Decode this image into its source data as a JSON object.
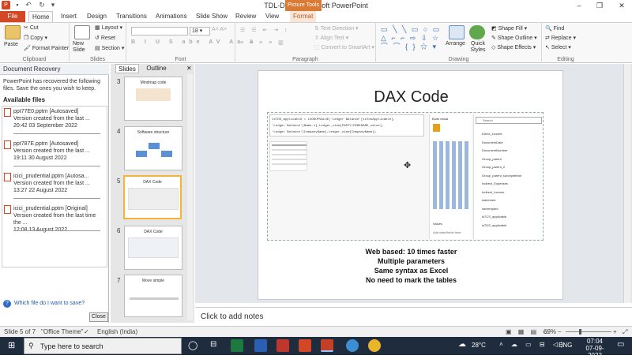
{
  "window": {
    "title": "TDL-DAX - Microsoft PowerPoint",
    "context_tab": "Picture Tools"
  },
  "tabs": [
    "File",
    "Home",
    "Insert",
    "Design",
    "Transitions",
    "Animations",
    "Slide Show",
    "Review",
    "View",
    "Format"
  ],
  "ribbon": {
    "clipboard": {
      "paste": "Paste",
      "cut": "Cut",
      "copy": "Copy",
      "format_painter": "Format Painter",
      "label": "Clipboard"
    },
    "slides": {
      "new_slide": "New Slide",
      "layout": "Layout",
      "reset": "Reset",
      "section": "Section",
      "label": "Slides"
    },
    "font": {
      "size": "18",
      "label": "Font"
    },
    "paragraph": {
      "text_direction": "Text Direction",
      "align_text": "Align Text",
      "convert_smartart": "Convert to SmartArt",
      "label": "Paragraph"
    },
    "drawing": {
      "arrange": "Arrange",
      "quick_styles": "Quick Styles",
      "shape_fill": "Shape Fill",
      "shape_outline": "Shape Outline",
      "shape_effects": "Shape Effects",
      "label": "Drawing"
    },
    "editing": {
      "find": "Find",
      "replace": "Replace",
      "select": "Select",
      "label": "Editing"
    }
  },
  "doc_recovery": {
    "title": "Document Recovery",
    "message": "PowerPoint has recovered the following files. Save the ones you wish to keep.",
    "available": "Available files",
    "files": [
      {
        "name": "ppt77E0.pptm  [Autosaved]",
        "desc": "Version created from the last ...",
        "time": "20:42 03 September 2022"
      },
      {
        "name": "ppt787E.pptm  [Autosaved]",
        "desc": "Version created from the last ...",
        "time": "19:11 30 August 2022"
      },
      {
        "name": "icici_prudential.pptm  [Autosa...",
        "desc": "Version created from the last ...",
        "time": "13:27 22 August 2022"
      },
      {
        "name": "icici_prudential.pptm  [Original]",
        "desc": "Version created from the last time the ...",
        "time": "12:08 13 August 2022"
      }
    ],
    "help_link": "Which file do I want to save?",
    "close": "Close"
  },
  "slides_pane": {
    "tabs": [
      "Slides",
      "Outline"
    ],
    "thumbs": [
      {
        "num": "3",
        "title": "Mindmap code"
      },
      {
        "num": "4",
        "title": "Software structure"
      },
      {
        "num": "5",
        "title": "DAX Code"
      },
      {
        "num": "6",
        "title": "DAX Code"
      },
      {
        "num": "7",
        "title": "Move simple"
      }
    ]
  },
  "slide": {
    "title": "DAX Code",
    "code_lines": [
      "IsTDS_applicable = LOOKUPVALUE('Ledger Balance'[isTdsApplicable],",
      "'Ledger Balance'[Name.1],Ledger_view[PARTY/DEBENARE_value],",
      "'Ledger Balance'[CompanyName],Ledger_view[CompanyName])"
    ],
    "panel_items": [
      "Direct_income",
      "DocumentDate",
      "DocumentNumber",
      "Group_parent",
      "Group_parent_2",
      "Group_parent_sundrydebtor",
      "Indirect_Expenses",
      "Indirect_Income",
      "isdeemed",
      "isexempted",
      "isTCS_applicable",
      "isTDS_applicable"
    ],
    "search_placeholder": "Search",
    "build_visual": "Build visual",
    "values": "Values",
    "add_fields": "Add data fields here",
    "bullets": [
      "Web  based: 10 times faster",
      "Multiple parameters",
      "Same syntax as Excel",
      "No need to mark the tables"
    ]
  },
  "notes_placeholder": "Click to add notes",
  "status": {
    "slide": "Slide 5 of 7",
    "theme": "\"Office Theme\"",
    "language": "English (India)",
    "zoom": "69%"
  },
  "taskbar": {
    "search_placeholder": "Type here to search",
    "weather": "28°C",
    "lang": "ENG",
    "time": "07:04",
    "date": "07-09-2022"
  }
}
